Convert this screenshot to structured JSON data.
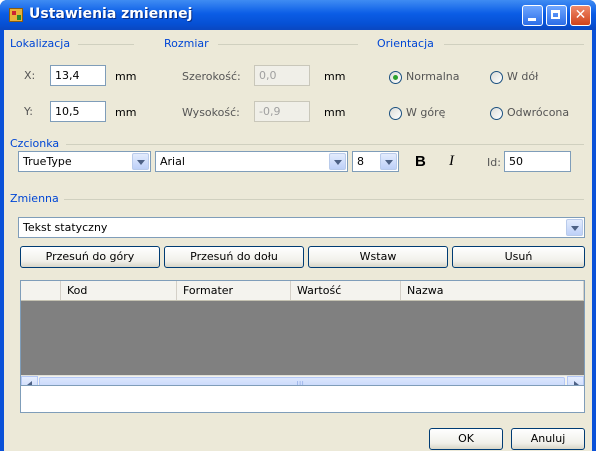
{
  "window": {
    "title": "Ustawienia zmiennej"
  },
  "location": {
    "group": "Lokalizacja",
    "x_label": "X:",
    "x_value": "13,4",
    "y_label": "Y:",
    "y_value": "10,5",
    "unit": "mm"
  },
  "size": {
    "group": "Rozmiar",
    "width_label": "Szerokość:",
    "width_value": "0,0",
    "height_label": "Wysokość:",
    "height_value": "-0,9",
    "unit": "mm"
  },
  "orientation": {
    "group": "Orientacja",
    "normal": "Normalna",
    "down": "W dół",
    "up": "W górę",
    "reversed": "Odwrócona",
    "selected": "Normalna"
  },
  "font": {
    "group": "Czcionka",
    "type": "TrueType",
    "family": "Arial",
    "size": "8",
    "bold": "B",
    "italic": "I",
    "id_label": "Id:",
    "id_value": "50"
  },
  "variable": {
    "group": "Zmienna",
    "selected": "Tekst statyczny"
  },
  "buttons": {
    "move_up": "Przesuń do góry",
    "move_down": "Przesuń do dołu",
    "insert": "Wstaw",
    "delete": "Usuń",
    "ok": "OK",
    "cancel": "Anuluj"
  },
  "grid": {
    "columns": [
      "Kod",
      "Formater",
      "Wartość",
      "Nazwa"
    ]
  },
  "colors": {
    "title_blue": "#0a51d8",
    "group_label": "#0046d5",
    "grid_bg": "#808080"
  }
}
